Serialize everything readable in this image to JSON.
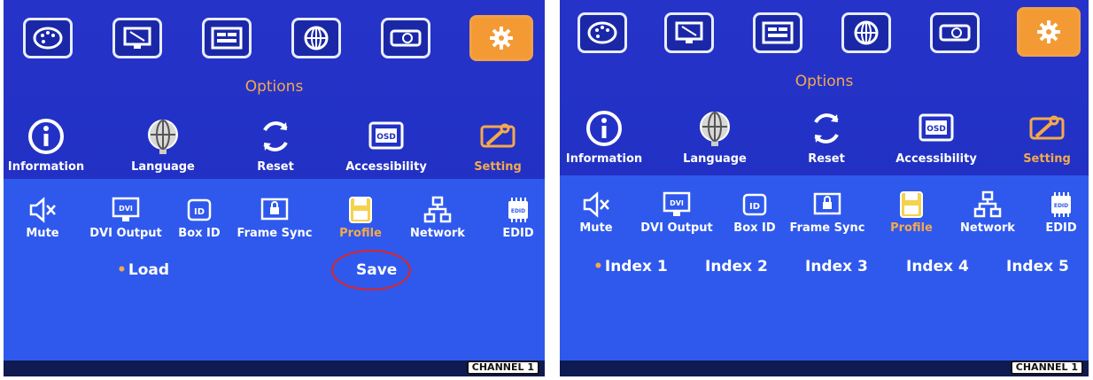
{
  "colors": {
    "screen_bg": "#2533c9",
    "lower_bg": "#2f59ec",
    "accent": "#f4a94d",
    "highlight_circle": "#e3231c"
  },
  "top_icons": [
    "palette-icon",
    "monitor-tools-icon",
    "sliders-icon",
    "globe-icon",
    "projector-icon",
    "gear-icon"
  ],
  "left": {
    "menu_title": "Options",
    "sub_items": [
      "Information",
      "Language",
      "Reset",
      "Accessibility",
      "Setting"
    ],
    "low_items": [
      "Mute",
      "DVI Output",
      "Box ID",
      "Frame Sync",
      "Profile",
      "Network",
      "EDID"
    ],
    "options": {
      "load": "Load",
      "save": "Save"
    },
    "channel": "CHANNEL 1"
  },
  "right": {
    "menu_title": "Options",
    "sub_items": [
      "Information",
      "Language",
      "Reset",
      "Accessibility",
      "Setting"
    ],
    "low_items": [
      "Mute",
      "DVI Output",
      "Box ID",
      "Frame Sync",
      "Profile",
      "Network",
      "EDID"
    ],
    "indexes": [
      "Index 1",
      "Index 2",
      "Index 3",
      "Index 4",
      "Index 5"
    ],
    "channel": "CHANNEL 1"
  }
}
